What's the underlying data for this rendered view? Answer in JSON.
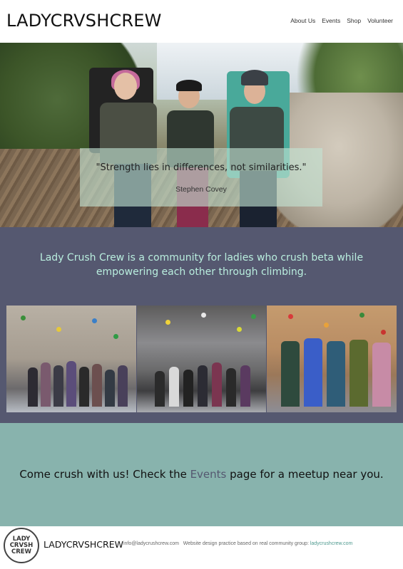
{
  "header": {
    "logo": "LADYCRVSHCREW",
    "nav": [
      {
        "label": "About Us"
      },
      {
        "label": "Events"
      },
      {
        "label": "Shop"
      },
      {
        "label": "Volunteer"
      }
    ]
  },
  "hero": {
    "quote": "\"Strength lies in differences, not similarities.\"",
    "author": "Stephen Covey"
  },
  "mission": {
    "text": "Lady Crush Crew is a community for ladies who crush beta while empowering each other through climbing."
  },
  "cta": {
    "before": "Come crush with us! Check the ",
    "link": "Events",
    "after": " page for a meetup near you."
  },
  "footer": {
    "badge_lines": [
      "LADY",
      "CRVSH",
      "CREW"
    ],
    "logo": "LADYCRVSHCREW",
    "email": "info@ladycrushcrew.com",
    "note": "Website design practice based on real community group:",
    "group_link": "ladycrushcrew.com"
  },
  "colors": {
    "mission_bg": "#555870",
    "mission_text": "#b9eede",
    "cta_bg": "#88b3ad",
    "link": "#4f9a8f"
  }
}
